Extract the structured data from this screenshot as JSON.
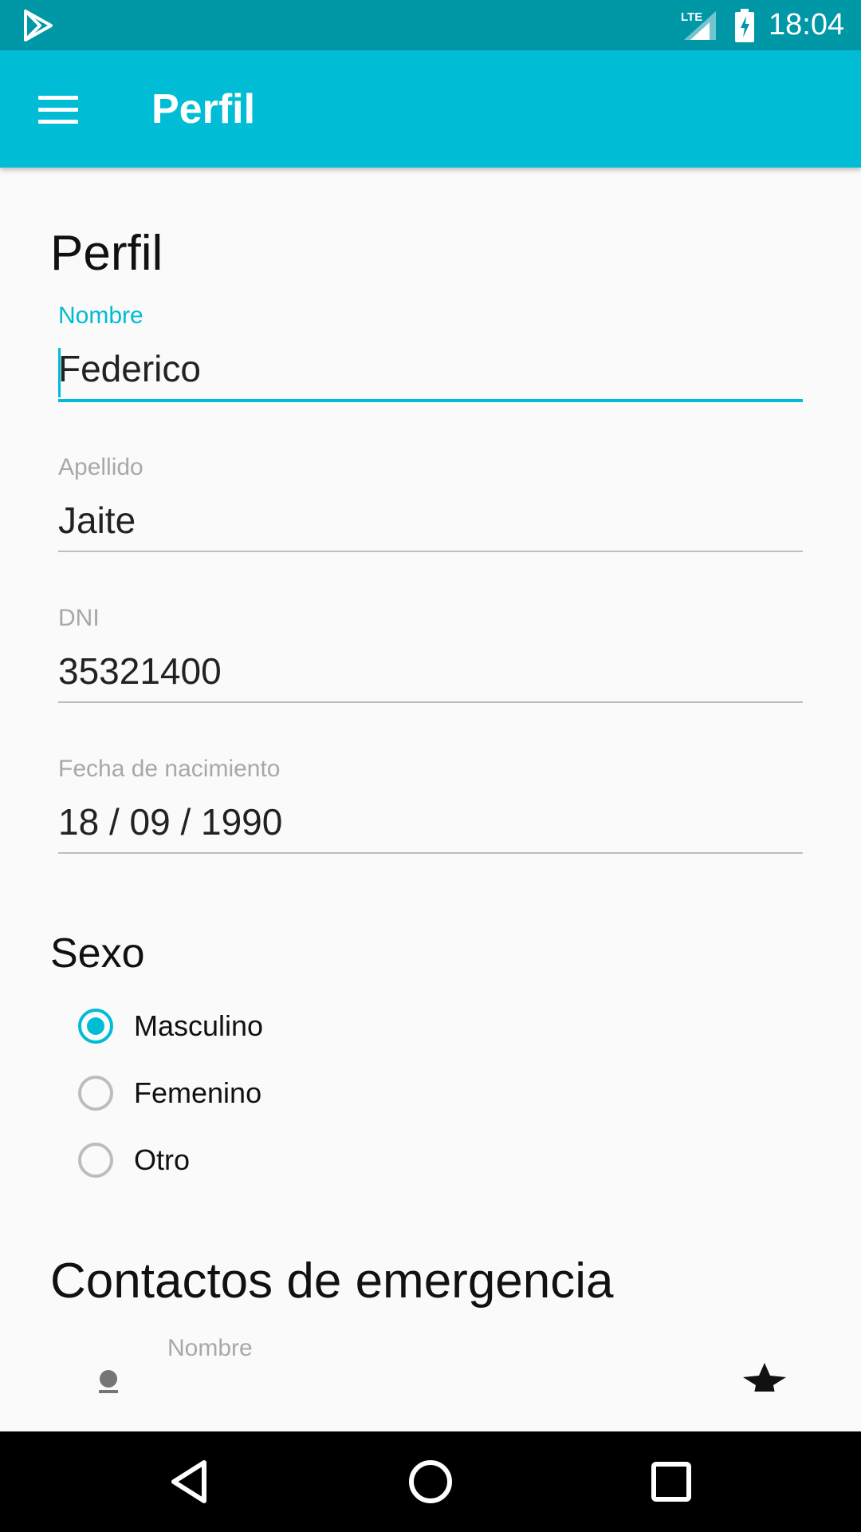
{
  "status_bar": {
    "time": "18:04",
    "network_label": "LTE",
    "icons": [
      "play-store-icon",
      "lte-signal-icon",
      "battery-charging-icon"
    ]
  },
  "app_bar": {
    "title": "Perfil",
    "menu_icon": "hamburger-menu-icon",
    "background": "#00bcd4"
  },
  "page": {
    "heading": "Perfil",
    "fields": [
      {
        "label": "Nombre",
        "value": "Federico",
        "focused": true
      },
      {
        "label": "Apellido",
        "value": "Jaite",
        "focused": false
      },
      {
        "label": "DNI",
        "value": "35321400",
        "focused": false
      },
      {
        "label": "Fecha de nacimiento",
        "value": "18 / 09 / 1990",
        "focused": false
      }
    ],
    "sex_section": {
      "title": "Sexo",
      "options": [
        {
          "label": "Masculino",
          "checked": true
        },
        {
          "label": "Femenino",
          "checked": false
        },
        {
          "label": "Otro",
          "checked": false
        }
      ]
    },
    "emergency_section": {
      "title": "Contactos de emergencia",
      "contact_field_label": "Nombre",
      "icons": [
        "person-icon",
        "star-icon"
      ]
    }
  },
  "nav_bar": {
    "buttons": [
      "back-icon",
      "home-icon",
      "recents-icon"
    ]
  },
  "colors": {
    "accent": "#00bcd4",
    "status_bar": "#0097a7",
    "text_primary": "#222222",
    "hint": "#a8a8a8"
  }
}
